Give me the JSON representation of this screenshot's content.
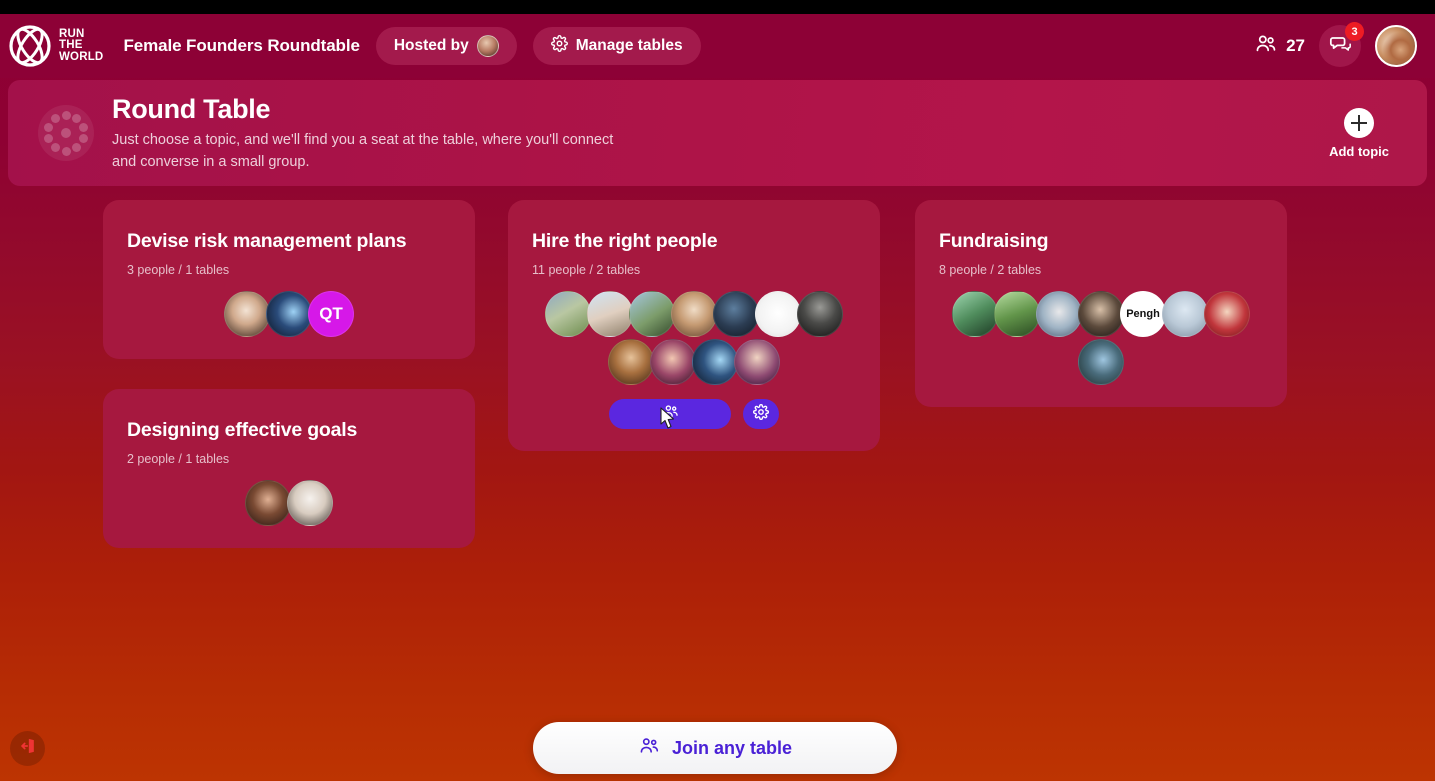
{
  "topbar": {
    "logo_line1": "RUN",
    "logo_line2": "THE",
    "logo_line3": "WORLD",
    "event_title": "Female Founders Roundtable",
    "hosted_by_label": "Hosted by",
    "manage_tables_label": "Manage tables",
    "viewer_count": "27",
    "chat_badge": "3",
    "icons": {
      "logo": "run-the-world-logo",
      "gear": "gear-icon",
      "people": "people-icon",
      "chat": "chat-bubble-icon",
      "avatar": "user-avatar"
    }
  },
  "banner": {
    "title": "Round Table",
    "subtitle": "Just choose a topic, and we'll find you a seat at the table, where you'll connect and converse in a small group.",
    "add_topic_label": "Add topic",
    "icon": "round-table-icon"
  },
  "topics": [
    {
      "id": "devise-risk-management-plans",
      "column": 1,
      "title": "Devise risk management plans",
      "meta": "3 people / 1 tables",
      "people": 3,
      "tables": 1,
      "has_actions": false,
      "avatar_rows": [
        [
          {
            "type": "photo",
            "bg": "radial-gradient(circle at 48% 42%, #f3e3d4 0%, #d0a98c 40%, #2c1c14 100%)"
          },
          {
            "type": "photo",
            "bg": "radial-gradient(circle at 60% 45%, #9ed2f5 0%, #2a4b7a 45%, #0b1322 100%)"
          },
          {
            "type": "initials",
            "label": "QT",
            "bg": "#d618e8"
          }
        ]
      ]
    },
    {
      "id": "hire-the-right-people",
      "column": 2,
      "title": "Hire the right people",
      "meta": "11 people / 2 tables",
      "people": 11,
      "tables": 2,
      "has_actions": true,
      "join_icon": "join-table-icon",
      "settings_icon": "gear-icon",
      "avatar_rows": [
        [
          {
            "type": "photo",
            "bg": "linear-gradient(150deg,#8fa9c2 0%,#b9c7a2 45%,#6c8b4c 100%)"
          },
          {
            "type": "photo",
            "bg": "linear-gradient(160deg,#cfe3f2 0%,#e0cfc0 50%,#8e7f6a 100%)"
          },
          {
            "type": "photo",
            "bg": "linear-gradient(145deg,#a5c7e0 0%,#7c9c6a 55%,#33492b 100%)"
          },
          {
            "type": "photo",
            "bg": "radial-gradient(circle at 50% 40%, #f0dcc6 0%, #c59a72 45%, #5c3f2b 100%)"
          },
          {
            "type": "photo",
            "bg": "radial-gradient(circle at 45% 38%, #5d7e9e 0%, #2b3c52 50%, #101720 100%)"
          },
          {
            "type": "photo",
            "bg": "radial-gradient(circle at 50% 48%, #ffffff 0%, #f3f3f3 60%, #d9d9d9 100%)"
          },
          {
            "type": "photo",
            "bg": "radial-gradient(circle at 50% 35%, #9a9a96 0%, #4a4a48 45%, #111111 100%)"
          }
        ],
        [
          {
            "type": "photo",
            "bg": "radial-gradient(circle at 50% 40%, #e6c29a 0%, #a8703f 45%, #3a2312 100%)"
          },
          {
            "type": "photo",
            "bg": "radial-gradient(circle at 48% 42%, #f2c7b2 0%, #9a4668 50%, #2a1020 100%)"
          },
          {
            "type": "photo",
            "bg": "radial-gradient(circle at 62% 45%, #a5d8f5 0%, #2f5480 45%, #0c1320 100%)"
          },
          {
            "type": "photo",
            "bg": "radial-gradient(circle at 50% 40%, #f0d4c2 0%, #8e4a72 55%, #2a1030 100%)"
          }
        ]
      ]
    },
    {
      "id": "fundraising",
      "column": 3,
      "title": "Fundraising",
      "meta": "8 people / 2 tables",
      "people": 8,
      "tables": 2,
      "has_actions": false,
      "avatar_rows": [
        [
          {
            "type": "photo",
            "bg": "linear-gradient(150deg,#9fd6b0 0%,#4f8c5c 50%,#1d3a24 100%)"
          },
          {
            "type": "photo",
            "bg": "linear-gradient(160deg,#b6dca0 0%,#62954a 50%,#2a4a22 100%)"
          },
          {
            "type": "photo",
            "bg": "radial-gradient(circle at 50% 45%, #e8e8ea 0%, #9fb3c4 50%, #44546a 100%)"
          },
          {
            "type": "photo",
            "bg": "radial-gradient(circle at 48% 40%, #d8c0a8 0%, #5c4a3c 50%, #161210 100%)"
          },
          {
            "type": "initials",
            "label": "Pengh",
            "bg": "#ffffff",
            "color": "#111111",
            "size": 11
          },
          {
            "type": "photo",
            "bg": "radial-gradient(circle at 50% 40%, #dde8f2 0%, #b9c8d6 50%, #7d8c9c 100%)"
          },
          {
            "type": "photo",
            "bg": "radial-gradient(circle at 50% 45%, #f4d6c0 0%, #c1363c 55%, #6c1418 100%)"
          }
        ],
        [
          {
            "type": "photo",
            "bg": "radial-gradient(circle at 55% 45%, #9fc6e0 0%, #4a6c7c 45%, #1c2c2a 100%)"
          }
        ]
      ]
    },
    {
      "id": "designing-effective-goals",
      "column": 1,
      "title": "Designing effective goals",
      "meta": "2 people / 1 tables",
      "people": 2,
      "tables": 1,
      "has_actions": false,
      "avatar_rows": [
        [
          {
            "type": "photo",
            "bg": "radial-gradient(circle at 50% 42%, #e0b093 0%, #7a4a33 45%, #231410 100%)"
          },
          {
            "type": "photo",
            "bg": "radial-gradient(circle at 50% 40%, #f6f2ee 0%, #d8ccc0 45%, #3a3430 100%)"
          }
        ]
      ]
    }
  ],
  "footer": {
    "join_any_label": "Join any table",
    "join_icon": "people-icon",
    "leave_icon": "leave-exit-icon"
  },
  "colors": {
    "header_bg": "#8D0136",
    "banner_bg": "#A8124A",
    "card_bg": "#A6183F",
    "accent_purple": "#5B27E0",
    "badge_red": "#ED1C24",
    "initials_magenta": "#D618E8"
  }
}
